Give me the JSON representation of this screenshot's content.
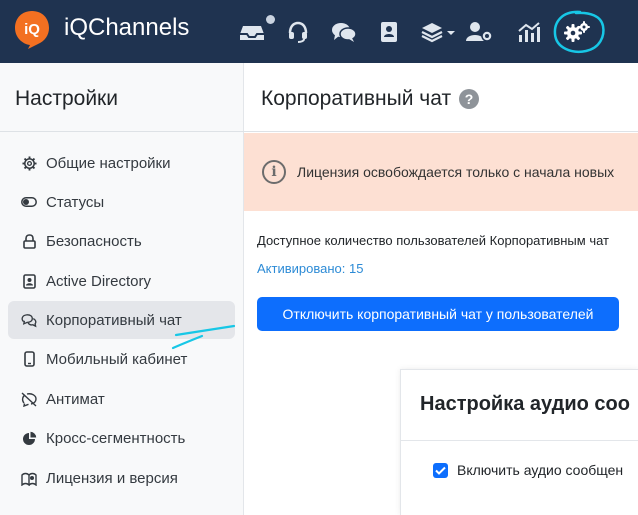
{
  "header": {
    "brand": "iQChannels",
    "logo_text": "iQ",
    "icons": [
      "inbox-icon",
      "headset-icon",
      "chat-icon",
      "contacts-icon",
      "layers-dropdown-icon",
      "users-settings-icon",
      "analytics-icon",
      "settings-icon"
    ]
  },
  "sidebar": {
    "title": "Настройки",
    "items": [
      {
        "label": "Общие настройки",
        "icon": "gear-icon"
      },
      {
        "label": "Статусы",
        "icon": "toggle-icon"
      },
      {
        "label": "Безопасность",
        "icon": "lock-icon"
      },
      {
        "label": "Active Directory",
        "icon": "id-card-icon"
      },
      {
        "label": "Корпоративный чат",
        "icon": "chats-icon",
        "active": true
      },
      {
        "label": "Мобильный кабинет",
        "icon": "phone-icon"
      },
      {
        "label": "Антимат",
        "icon": "no-chat-icon"
      },
      {
        "label": "Кросс-сегментность",
        "icon": "pie-chart-icon"
      },
      {
        "label": "Лицензия и версия",
        "icon": "license-icon"
      }
    ]
  },
  "main": {
    "title": "Корпоративный чат",
    "help": "?",
    "alert": {
      "icon_glyph": "i",
      "text": "Лицензия освобождается только с начала новых"
    },
    "info_text": "Доступное количество пользователей Корпоративным чат",
    "activated": "Активировано: 15",
    "disable_button": "Отключить корпоративный чат у пользователей",
    "audio_card": {
      "title": "Настройка аудио соо",
      "checkbox_label": "Включить аудио сообщен",
      "checkbox_checked": true
    }
  },
  "colors": {
    "topbar": "#1f3350",
    "logo": "#f37021",
    "primary": "#0d6efd",
    "alert_bg": "#fde0d3",
    "annotation": "#17c7e6"
  }
}
